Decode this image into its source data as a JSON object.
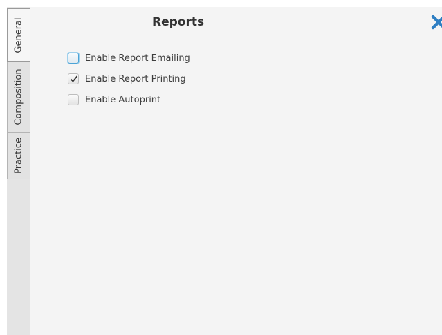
{
  "tabs": [
    {
      "label": "General",
      "active": true
    },
    {
      "label": "Composition",
      "active": false
    },
    {
      "label": "Practice",
      "active": false
    }
  ],
  "panel": {
    "title": "Reports",
    "options": [
      {
        "label": "Enable Report Emailing",
        "checked": false,
        "focused": true
      },
      {
        "label": "Enable Report Printing",
        "checked": true,
        "focused": false
      },
      {
        "label": "Enable Autoprint",
        "checked": false,
        "focused": false
      }
    ]
  },
  "colors": {
    "close_icon": "#2f7fc3",
    "focus_ring": "#4ba3d6"
  },
  "icons": {
    "close": "close-icon",
    "check": "checkmark-icon"
  }
}
